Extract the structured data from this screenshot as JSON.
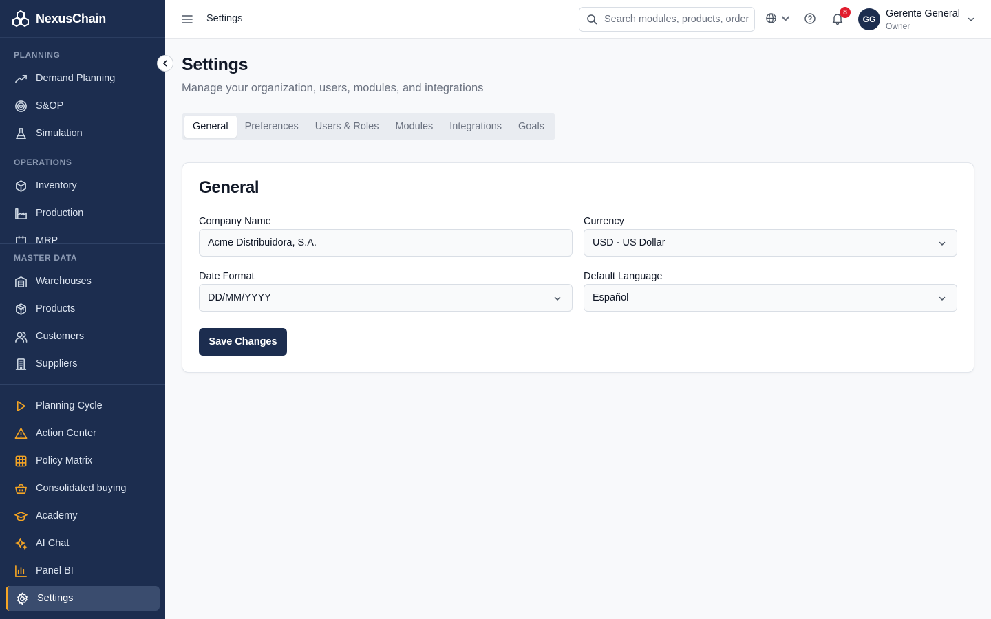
{
  "brand": {
    "name": "NexusChain"
  },
  "sidebar": {
    "sections": [
      {
        "label": "PLANNING"
      },
      {
        "label": "OPERATIONS"
      },
      {
        "label": "MASTER DATA"
      }
    ],
    "planning": [
      {
        "label": "Demand Planning",
        "icon": "trend-icon"
      },
      {
        "label": "S&OP",
        "icon": "target-icon"
      },
      {
        "label": "Simulation",
        "icon": "flask-icon"
      }
    ],
    "operations": [
      {
        "label": "Inventory",
        "icon": "box-icon"
      },
      {
        "label": "Production",
        "icon": "factory-icon"
      },
      {
        "label": "MRP",
        "icon": "mrp-icon"
      }
    ],
    "master": [
      {
        "label": "Warehouses",
        "icon": "warehouse-icon"
      },
      {
        "label": "Products",
        "icon": "package-icon"
      },
      {
        "label": "Customers",
        "icon": "users-icon"
      },
      {
        "label": "Suppliers",
        "icon": "building-icon"
      }
    ],
    "tools": [
      {
        "label": "Planning Cycle",
        "icon": "play-icon"
      },
      {
        "label": "Action Center",
        "icon": "alert-icon"
      },
      {
        "label": "Policy Matrix",
        "icon": "grid-icon"
      },
      {
        "label": "Consolidated buying",
        "icon": "basket-icon"
      },
      {
        "label": "Academy",
        "icon": "graduation-icon"
      },
      {
        "label": "AI Chat",
        "icon": "sparkle-icon"
      },
      {
        "label": "Panel BI",
        "icon": "bar-chart-icon"
      },
      {
        "label": "Settings",
        "icon": "gear-icon"
      }
    ],
    "accent_color": "#f5a524",
    "background_color": "#1c2d4f"
  },
  "topbar": {
    "title": "Settings",
    "search_placeholder": "Search modules, products, orders...",
    "notification_count": "8",
    "user": {
      "initials": "GG",
      "name": "Gerente General",
      "role": "Owner"
    }
  },
  "main": {
    "title": "Settings",
    "subtitle": "Manage your organization, users, modules, and integrations",
    "tabs": [
      {
        "label": "General"
      },
      {
        "label": "Preferences"
      },
      {
        "label": "Users & Roles"
      },
      {
        "label": "Modules"
      },
      {
        "label": "Integrations"
      },
      {
        "label": "Goals"
      }
    ],
    "card": {
      "title": "General",
      "company_name": {
        "label": "Company Name",
        "value": "Acme Distribuidora, S.A."
      },
      "currency": {
        "label": "Currency",
        "value": "USD - US Dollar"
      },
      "date_format": {
        "label": "Date Format",
        "value": "DD/MM/YYYY"
      },
      "default_language": {
        "label": "Default Language",
        "value": "Español"
      },
      "save_label": "Save Changes"
    }
  }
}
